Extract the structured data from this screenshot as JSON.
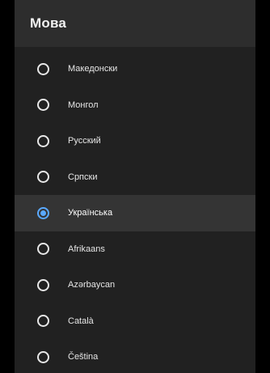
{
  "header": {
    "title": "Мова"
  },
  "languages": [
    {
      "label": "Македонски",
      "selected": false
    },
    {
      "label": "Монгол",
      "selected": false
    },
    {
      "label": "Русский",
      "selected": false
    },
    {
      "label": "Српски",
      "selected": false
    },
    {
      "label": "Українська",
      "selected": true
    },
    {
      "label": "Afrikaans",
      "selected": false
    },
    {
      "label": "Azərbaycan",
      "selected": false
    },
    {
      "label": "Català",
      "selected": false
    },
    {
      "label": "Čeština",
      "selected": false
    }
  ],
  "colors": {
    "background": "#000000",
    "panel": "#212121",
    "header": "#2d2d2d",
    "selected_row": "#343434",
    "accent": "#5aa9ff",
    "radio_unchecked": "#e8e8e8",
    "text": "#e6e6e6"
  }
}
